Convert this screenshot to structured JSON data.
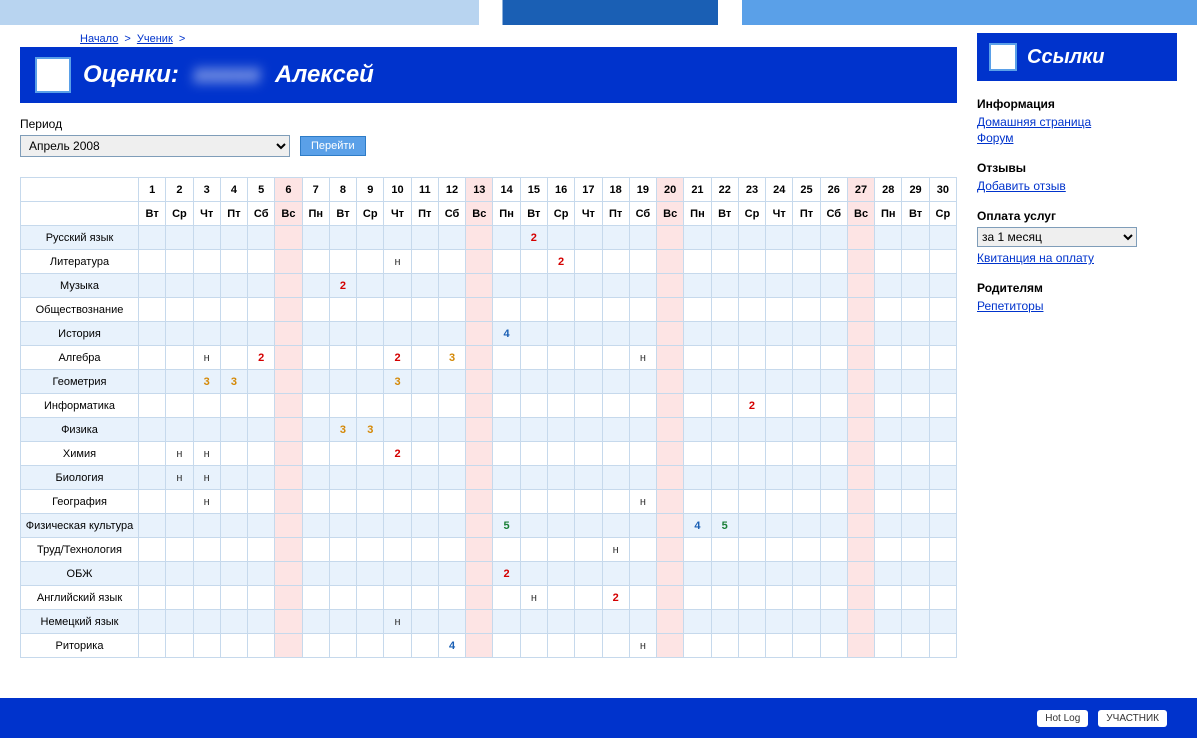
{
  "breadcrumb": {
    "home": "Начало",
    "student": "Ученик"
  },
  "header": {
    "title_prefix": "Оценки:",
    "title_name": "Алексей"
  },
  "period": {
    "label": "Период",
    "selected": "Апрель 2008",
    "go": "Перейти"
  },
  "days": [
    1,
    2,
    3,
    4,
    5,
    6,
    7,
    8,
    9,
    10,
    11,
    12,
    13,
    14,
    15,
    16,
    17,
    18,
    19,
    20,
    21,
    22,
    23,
    24,
    25,
    26,
    27,
    28,
    29,
    30
  ],
  "weekdays": [
    "Вт",
    "Ср",
    "Чт",
    "Пт",
    "Сб",
    "Вс",
    "Пн",
    "Вт",
    "Ср",
    "Чт",
    "Пт",
    "Сб",
    "Вс",
    "Пн",
    "Вт",
    "Ср",
    "Чт",
    "Пт",
    "Сб",
    "Вс",
    "Пн",
    "Вт",
    "Ср",
    "Чт",
    "Пт",
    "Сб",
    "Вс",
    "Пн",
    "Вт",
    "Ср"
  ],
  "subjects": [
    {
      "name": "Русский язык",
      "cells": {
        "15": "2"
      }
    },
    {
      "name": "Литература",
      "cells": {
        "10": "н",
        "16": "2"
      }
    },
    {
      "name": "Музыка",
      "cells": {
        "8": "2"
      }
    },
    {
      "name": "Обществознание",
      "cells": {}
    },
    {
      "name": "История",
      "cells": {
        "14": "4"
      }
    },
    {
      "name": "Алгебра",
      "cells": {
        "3": "н",
        "5": "2",
        "10": "2",
        "12": "3",
        "19": "н"
      }
    },
    {
      "name": "Геометрия",
      "cells": {
        "3": "3",
        "4": "3",
        "10": "3"
      }
    },
    {
      "name": "Информатика",
      "cells": {
        "23": "2"
      }
    },
    {
      "name": "Физика",
      "cells": {
        "8": "3",
        "9": "3"
      }
    },
    {
      "name": "Химия",
      "cells": {
        "2": "н",
        "3": "н",
        "10": "2"
      }
    },
    {
      "name": "Биология",
      "cells": {
        "2": "н",
        "3": "н"
      }
    },
    {
      "name": "География",
      "cells": {
        "3": "н",
        "19": "н"
      }
    },
    {
      "name": "Физическая культура",
      "cells": {
        "14": "5",
        "21": "4",
        "22": "5"
      }
    },
    {
      "name": "Труд/Технология",
      "cells": {
        "18": "н"
      }
    },
    {
      "name": "ОБЖ",
      "cells": {
        "14": "2"
      }
    },
    {
      "name": "Английский язык",
      "cells": {
        "15": "н",
        "18": "2"
      }
    },
    {
      "name": "Немецкий язык",
      "cells": {
        "10": "н"
      }
    },
    {
      "name": "Риторика",
      "cells": {
        "12": "4",
        "19": "н"
      }
    }
  ],
  "sidebar": {
    "title": "Ссылки",
    "sections": [
      {
        "heading": "Информация",
        "links": [
          "Домашняя страница",
          "Форум"
        ]
      },
      {
        "heading": "Отзывы",
        "links": [
          "Добавить отзыв"
        ]
      },
      {
        "heading": "Оплата услуг",
        "select": "за 1 месяц",
        "links": [
          "Квитанция на оплату"
        ]
      },
      {
        "heading": "Родителям",
        "links": [
          "Репетиторы"
        ]
      }
    ]
  },
  "footer": {
    "badge1": "Hot Log",
    "badge2": "УЧАСТНИК"
  }
}
